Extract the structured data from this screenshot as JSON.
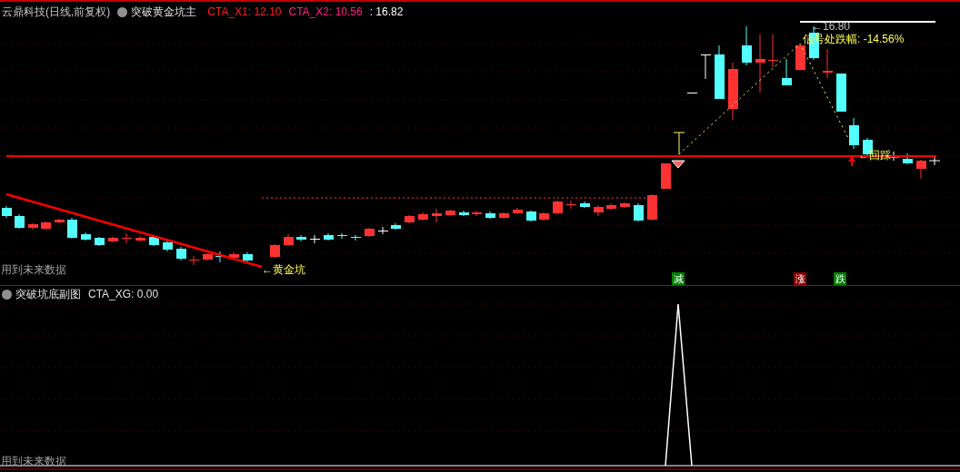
{
  "main_panel": {
    "title": "云鼎科技(日线,前复权)",
    "indicator": "突破黄金坑主",
    "values": [
      {
        "text": "CTA_X1: 12.10",
        "color": "#ff2020"
      },
      {
        "text": "CTA_X2: 10.56",
        "color": "#ff2080"
      },
      {
        "text": ": 16.82",
        "color": "#ffffff"
      }
    ],
    "annotations": [
      "←16.80",
      "信号处跌幅: -14.56%",
      "←回踩",
      "←黄金坑"
    ],
    "warning": "用到未来数据",
    "signals": [
      {
        "text": "减",
        "color": "#008000"
      },
      {
        "text": "涨",
        "color": "#8b0000"
      },
      {
        "text": "跌",
        "color": "#008000"
      }
    ]
  },
  "sub_panel": {
    "title": "突破坑底副图",
    "value": "CTA_XG: 0.00",
    "warning": "用到未来数据"
  }
}
